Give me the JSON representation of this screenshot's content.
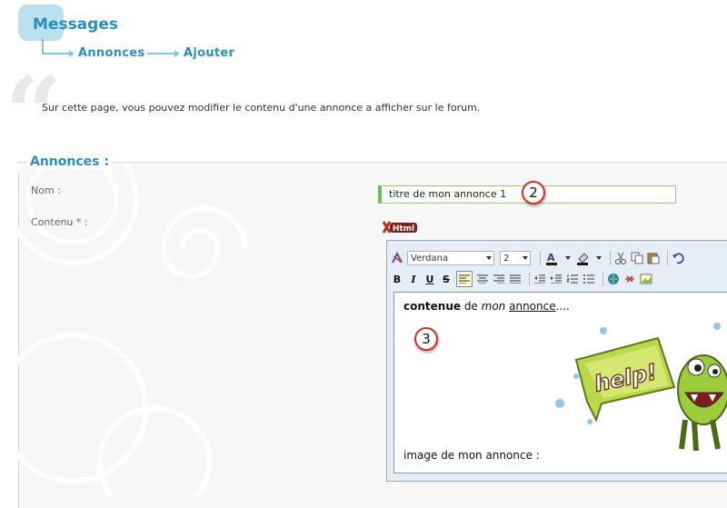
{
  "header": {
    "title": "Messages",
    "breadcrumb": [
      "Annonces",
      "Ajouter"
    ]
  },
  "description": "Sur cette page, vous pouvez modifier le contenu d'une annonce a afficher sur le forum.",
  "section": {
    "legend": "Annonces :",
    "nom_label": "Nom :",
    "contenu_label": "Contenu",
    "required_mark": "*",
    "contenu_colon": ":",
    "nom_value": "titre de mon annonce 1",
    "html_badge": "Html"
  },
  "callouts": {
    "first": "2",
    "second": "3"
  },
  "editor": {
    "font": "Verdana",
    "size": "2",
    "format_buttons": [
      "B",
      "I",
      "U",
      "S"
    ],
    "content": {
      "bold": "contenue",
      "t1": " de ",
      "italic": "mon",
      "t2": " ",
      "underline": "annonce",
      "t3": "...."
    },
    "image_caption": "image de mon annonce :",
    "image_text": "help!"
  },
  "colors": {
    "accent": "#2a8ec0",
    "input_border": "#6cc04a",
    "callout_ring": "#d52f21",
    "monster_green": "#9ccc3c"
  }
}
